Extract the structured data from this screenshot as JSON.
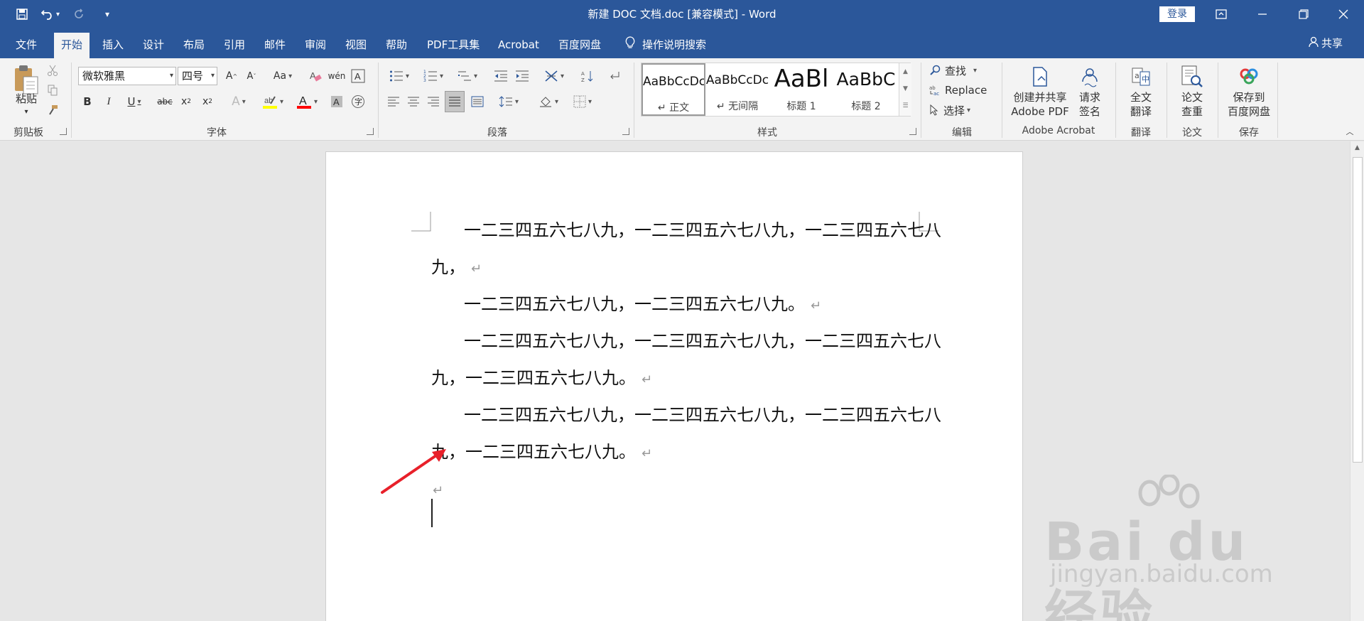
{
  "titlebar": {
    "title": "新建 DOC 文档.doc [兼容模式]  -  Word",
    "login": "登录",
    "qat_icons": [
      "save-icon",
      "undo-icon",
      "redo-icon",
      "customize-icon"
    ]
  },
  "tabs": {
    "items": [
      "文件",
      "开始",
      "插入",
      "设计",
      "布局",
      "引用",
      "邮件",
      "审阅",
      "视图",
      "帮助",
      "PDF工具集",
      "Acrobat",
      "百度网盘"
    ],
    "active": "开始",
    "tell_me": "操作说明搜索",
    "share": "共享"
  },
  "ribbon": {
    "clipboard": {
      "paste": "粘贴",
      "label": "剪贴板"
    },
    "font": {
      "name": "微软雅黑",
      "size": "四号",
      "change_case": "Aa",
      "label": "字体"
    },
    "paragraph": {
      "label": "段落"
    },
    "styles": {
      "label": "样式",
      "items": [
        {
          "sample": "AaBbCcDc",
          "name": "↵ 正文"
        },
        {
          "sample": "AaBbCcDc",
          "name": "↵ 无间隔"
        },
        {
          "sample": "AaBl",
          "name": "标题 1"
        },
        {
          "sample": "AaBbC",
          "name": "标题 2"
        }
      ]
    },
    "editing": {
      "find": "查找",
      "replace": "Replace",
      "select": "选择",
      "label": "编辑"
    },
    "acrobat": {
      "create_line1": "创建并共享",
      "create_line2": "Adobe PDF",
      "sign_line1": "请求",
      "sign_line2": "签名",
      "label": "Adobe Acrobat"
    },
    "translate": {
      "line1": "全文",
      "line2": "翻译",
      "label": "翻译"
    },
    "paper": {
      "line1": "论文",
      "line2": "查重",
      "label": "论文"
    },
    "save": {
      "line1": "保存到",
      "line2": "百度网盘",
      "label": "保存"
    }
  },
  "document": {
    "lines": [
      "一二三四五六七八九，一二三四五六七八九，一二三四五六七八",
      "九，",
      "一二三四五六七八九，一二三四五六七八九。",
      "一二三四五六七八九，一二三四五六七八九，一二三四五六七八",
      "九，一二三四五六七八九。",
      "一二三四五六七八九，一二三四五六七八九，一二三四五六七八",
      "九，一二三四五六七八九。"
    ],
    "paragraph_mark": "↵"
  },
  "watermark": {
    "logo": "Bai du 经验",
    "url": "jingyan.baidu.com"
  },
  "colors": {
    "accent": "#2b579a",
    "highlight": "#ffff00",
    "font_color": "#ff0000",
    "arrow": "#e8202a"
  }
}
